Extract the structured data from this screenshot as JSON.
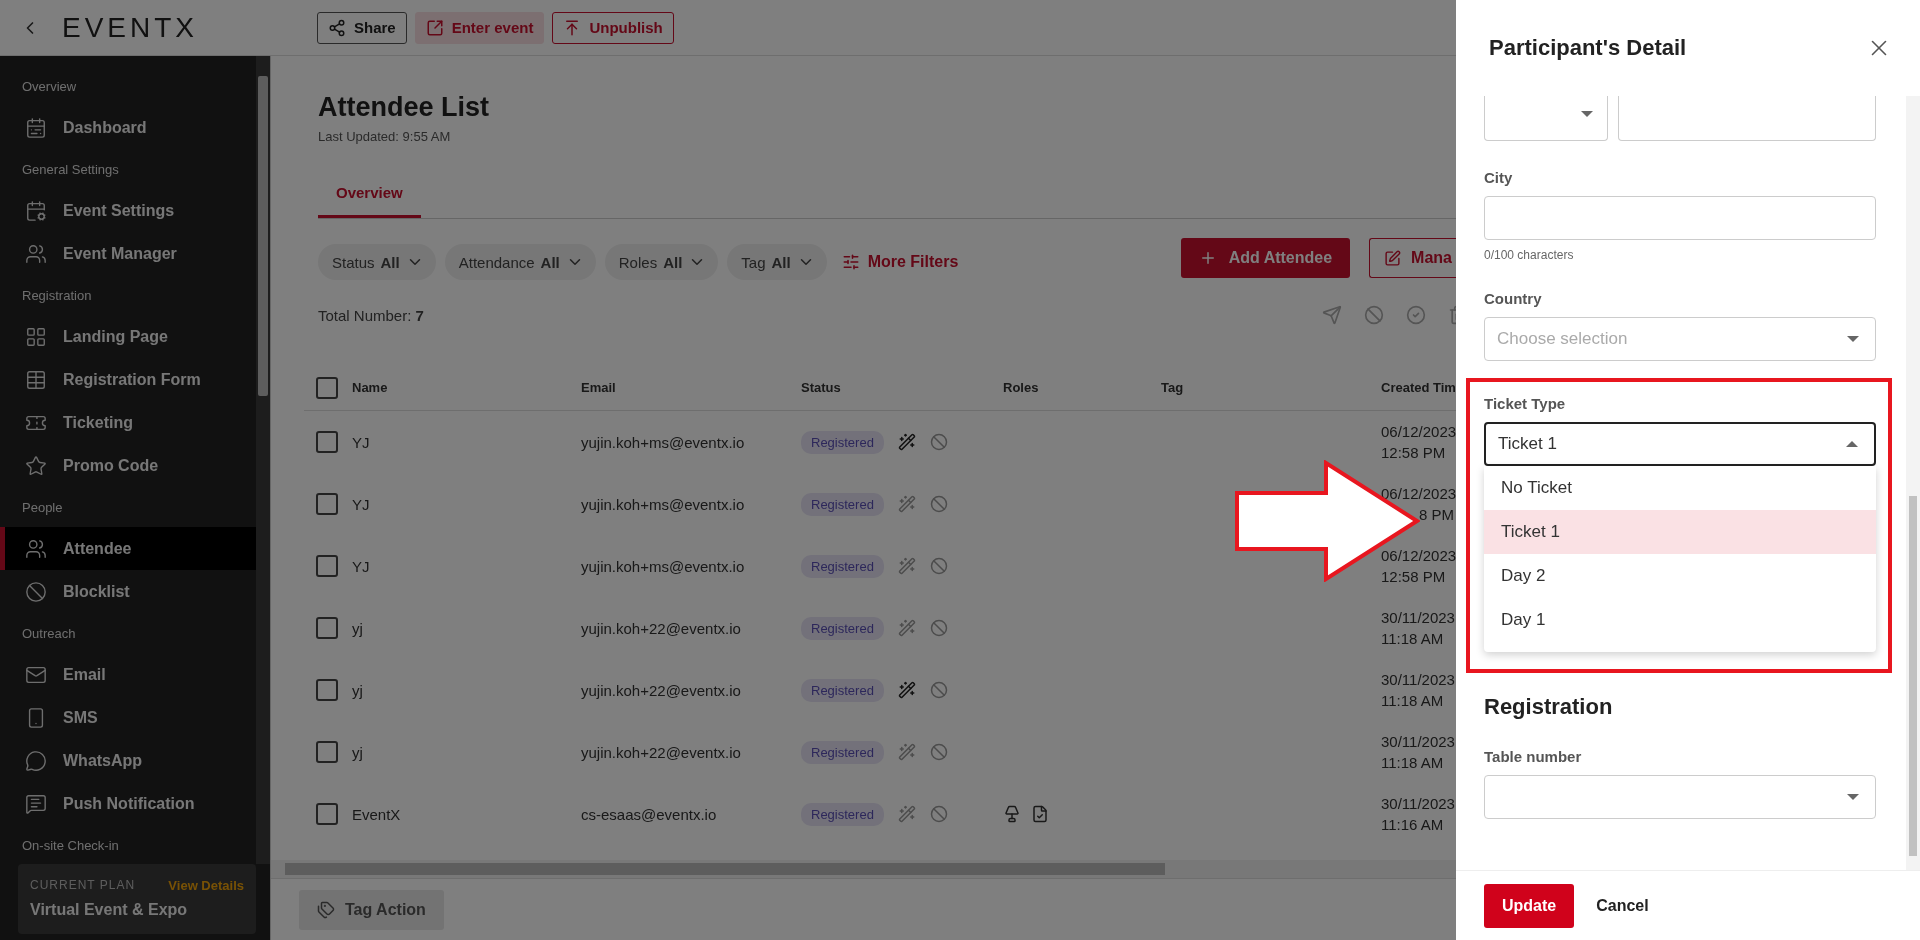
{
  "header": {
    "logo": "EVENTX",
    "buttons": [
      {
        "label": "Share",
        "kind": "share"
      },
      {
        "label": "Enter event",
        "kind": "enter"
      },
      {
        "label": "Unpublish",
        "kind": "unpublish"
      }
    ]
  },
  "sidebar": {
    "sections": [
      {
        "label": "Overview",
        "items": [
          {
            "label": "Dashboard",
            "selected": false
          }
        ]
      },
      {
        "label": "General Settings",
        "items": [
          {
            "label": "Event Settings",
            "selected": false
          },
          {
            "label": "Event Manager",
            "selected": false
          }
        ]
      },
      {
        "label": "Registration",
        "items": [
          {
            "label": "Landing Page",
            "selected": false
          },
          {
            "label": "Registration Form",
            "selected": false
          },
          {
            "label": "Ticketing",
            "selected": false
          },
          {
            "label": "Promo Code",
            "selected": false
          }
        ]
      },
      {
        "label": "People",
        "items": [
          {
            "label": "Attendee",
            "selected": true
          },
          {
            "label": "Blocklist",
            "selected": false
          }
        ]
      },
      {
        "label": "Outreach",
        "items": [
          {
            "label": "Email",
            "selected": false
          },
          {
            "label": "SMS",
            "selected": false
          },
          {
            "label": "WhatsApp",
            "selected": false
          },
          {
            "label": "Push Notification",
            "selected": false
          }
        ]
      },
      {
        "label": "On-site Check-in"
      }
    ],
    "plan": {
      "caption": "CURRENT PLAN",
      "link": "View Details",
      "name": "Virtual Event & Expo"
    }
  },
  "page": {
    "title": "Attendee List",
    "updated": "Last Updated: 9:55 AM",
    "tabs": [
      {
        "label": "Overview",
        "selected": true
      }
    ],
    "filters": [
      {
        "label": "Status",
        "value": "All"
      },
      {
        "label": "Attendance",
        "value": "All"
      },
      {
        "label": "Roles",
        "value": "All"
      },
      {
        "label": "Tag",
        "value": "All"
      }
    ],
    "more_filters": "More Filters",
    "add_button": "Add Attendee",
    "manage_button": "Mana",
    "total_label": "Total Number:",
    "total": "7"
  },
  "table": {
    "select_all_checked": false,
    "columns": [
      "Name",
      "Email",
      "Status",
      "Roles",
      "Tag",
      "Created Tim"
    ],
    "rows": [
      {
        "name": "YJ",
        "email": "yujin.koh+ms@eventx.io",
        "status": "Registered",
        "checked": false,
        "wand_active": true,
        "kind": "plain",
        "date": "06/12/2023",
        "time": "12:58 PM"
      },
      {
        "name": "YJ",
        "email": "yujin.koh+ms@eventx.io",
        "status": "Registered",
        "checked": false,
        "wand_active": false,
        "kind": "plain",
        "date": "06/12/2023",
        "time": "8 PM"
      },
      {
        "name": "YJ",
        "email": "yujin.koh+ms@eventx.io",
        "status": "Registered",
        "checked": false,
        "wand_active": false,
        "kind": "plain",
        "date": "06/12/2023",
        "time": "12:58 PM"
      },
      {
        "name": "yj",
        "email": "yujin.koh+22@eventx.io",
        "status": "Registered",
        "checked": false,
        "wand_active": false,
        "kind": "plain",
        "date": "30/11/2023",
        "time": "11:18 AM"
      },
      {
        "name": "yj",
        "email": "yujin.koh+22@eventx.io",
        "status": "Registered",
        "checked": false,
        "wand_active": true,
        "kind": "plain",
        "date": "30/11/2023",
        "time": "11:18 AM"
      },
      {
        "name": "yj",
        "email": "yujin.koh+22@eventx.io",
        "status": "Registered",
        "checked": false,
        "wand_active": false,
        "kind": "plain",
        "date": "30/11/2023",
        "time": "11:18 AM"
      },
      {
        "name": "EventX",
        "email": "cs-esaas@eventx.io",
        "status": "Registered",
        "checked": false,
        "wand_active": false,
        "kind": "roles",
        "date": "30/11/2023",
        "time": "11:16 AM"
      }
    ]
  },
  "tag_action": {
    "label": "Tag Action",
    "disabled": true
  },
  "drawer": {
    "title": "Participant's Detail",
    "city": {
      "label": "City",
      "counter": "0/100 characters"
    },
    "country": {
      "label": "Country",
      "placeholder": "Choose selection"
    },
    "ticket_type": {
      "label": "Ticket Type",
      "value": "Ticket 1",
      "expanded": true,
      "options": [
        {
          "label": "No Ticket",
          "selected": false
        },
        {
          "label": "Ticket 1",
          "selected": true
        },
        {
          "label": "Day 2",
          "selected": false
        },
        {
          "label": "Day 1",
          "selected": false
        }
      ]
    },
    "section": "Registration",
    "table_number": {
      "label": "Table number"
    },
    "buttons": {
      "update": "Update",
      "cancel": "Cancel"
    }
  }
}
